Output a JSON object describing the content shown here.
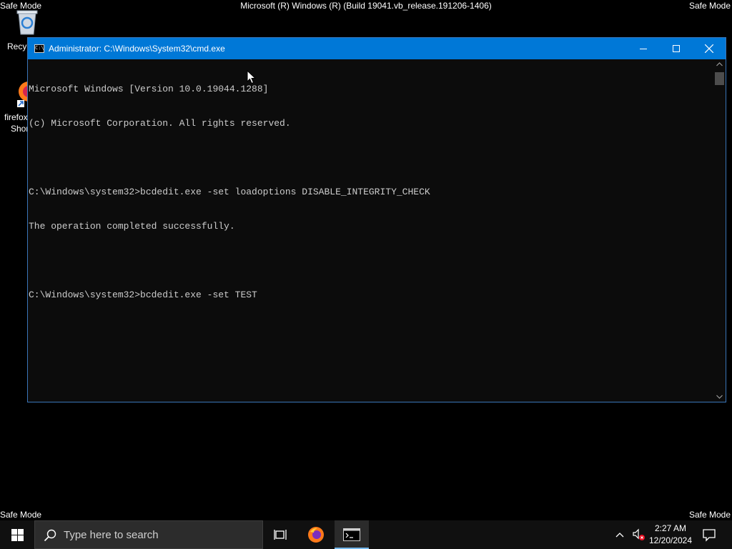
{
  "desktop": {
    "safe_mode_label": "Safe Mode",
    "banner": "Microsoft (R) Windows (R) (Build 19041.vb_release.191206-1406)",
    "icons": [
      {
        "label": "Recyc"
      },
      {
        "label_line1": "firefox",
        "label_line2": "Shor"
      }
    ]
  },
  "window": {
    "title": "Administrator: C:\\Windows\\System32\\cmd.exe",
    "console_lines": [
      "Microsoft Windows [Version 10.0.19044.1288]",
      "(c) Microsoft Corporation. All rights reserved.",
      "",
      "C:\\Windows\\system32>bcdedit.exe -set loadoptions DISABLE_INTEGRITY_CHECK",
      "The operation completed successfully.",
      "",
      "C:\\Windows\\system32>bcdedit.exe -set TEST"
    ],
    "console_bg": "#0c0c0c",
    "console_fg": "#cccccc",
    "titlebar_color": "#0078d7"
  },
  "taskbar": {
    "search_placeholder": "Type here to search",
    "time": "2:27 AM",
    "date": "12/20/2024",
    "accent": "#76b9ed"
  }
}
